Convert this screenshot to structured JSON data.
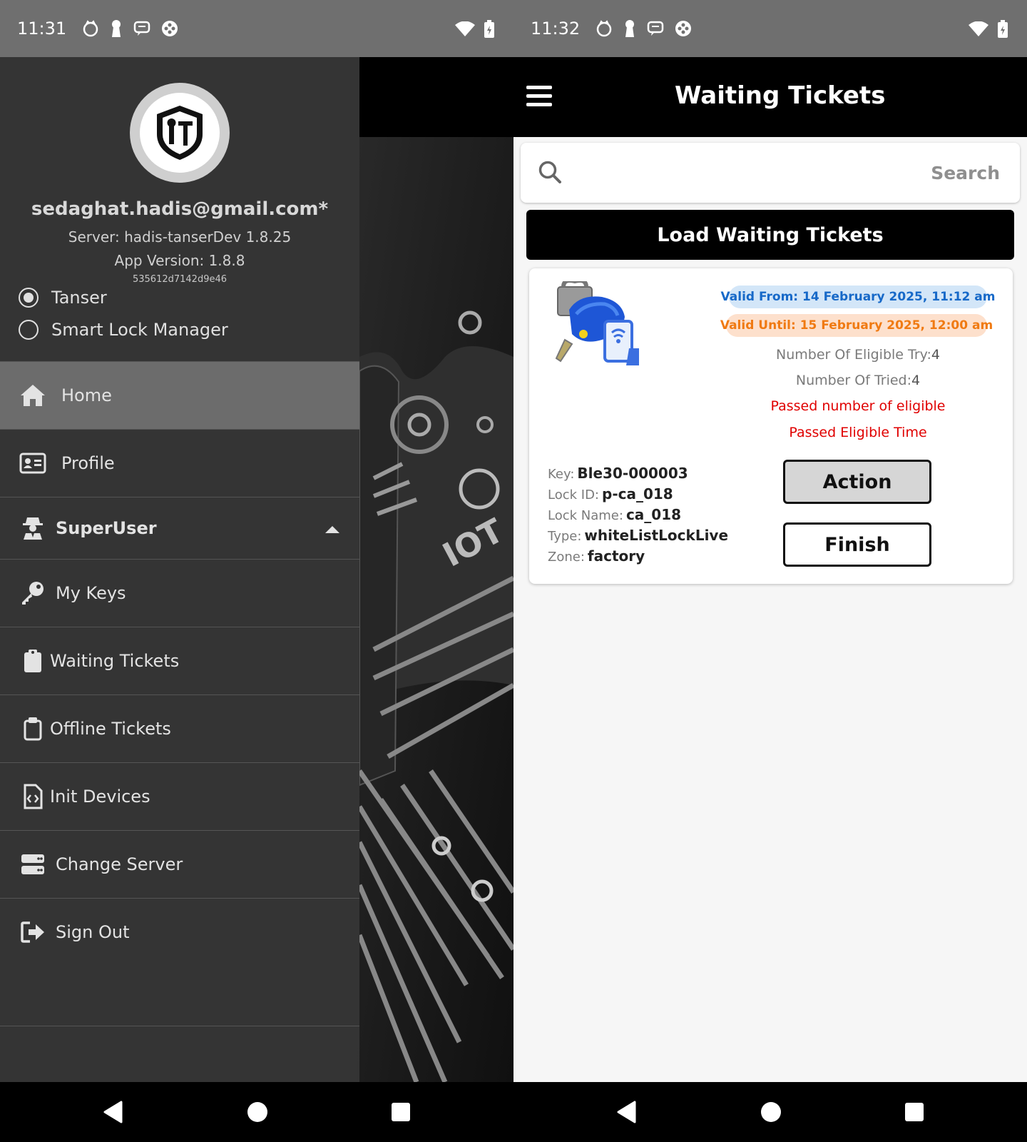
{
  "status_left": {
    "time": "11:31"
  },
  "status_right": {
    "time": "11:32"
  },
  "drawer": {
    "email": "sedaghat.hadis@gmail.com*",
    "server": "Server: hadis-tanserDev 1.8.25",
    "app_version": "App Version: 1.8.8",
    "device_hash": "535612d7142d9e46",
    "mode_options": [
      {
        "label": "Tanser",
        "selected": true
      },
      {
        "label": "Smart Lock Manager",
        "selected": false
      }
    ],
    "menu": [
      {
        "label": "Home",
        "icon": "home-icon",
        "active": true
      },
      {
        "label": "Profile",
        "icon": "id-card-icon"
      },
      {
        "label": "SuperUser",
        "icon": "user-secret-icon",
        "expanded": true
      },
      {
        "label": "My Keys",
        "icon": "key-icon"
      },
      {
        "label": "Waiting Tickets",
        "icon": "clipboard-icon"
      },
      {
        "label": "Offline Tickets",
        "icon": "clipboard-outline-icon"
      },
      {
        "label": "Init Devices",
        "icon": "file-code-icon"
      },
      {
        "label": "Change Server",
        "icon": "server-icon"
      },
      {
        "label": "Sign Out",
        "icon": "sign-out-icon"
      }
    ]
  },
  "appbar": {
    "title": "Waiting Tickets"
  },
  "search": {
    "placeholder": "Search"
  },
  "load_button": "Load Waiting Tickets",
  "ticket": {
    "valid_from": "Valid From: 14 February 2025, 11:12 am",
    "valid_until": "Valid Until: 15 February 2025, 12:00 am",
    "eligible_try_label": "Number Of Eligible Try:",
    "eligible_try_value": "4",
    "tried_label": "Number Of Tried:",
    "tried_value": "4",
    "warning_1": "Passed number of eligible",
    "warning_2": "Passed Eligible Time",
    "key_label": "Key:",
    "key_value": "Ble30-000003",
    "lock_id_label": "Lock ID:",
    "lock_id_value": "p-ca_018",
    "lock_name_label": "Lock Name:",
    "lock_name_value": "ca_018",
    "type_label": "Type:",
    "type_value": "whiteListLockLive",
    "zone_label": "Zone:",
    "zone_value": "factory",
    "action_label": "Action",
    "finish_label": "Finish"
  },
  "colors": {
    "drawer_bg": "#343434",
    "active_item_bg": "#6c6c6c",
    "valid_from_text": "#1769c8",
    "valid_until_text": "#f07a12",
    "warning_text": "#e00000"
  }
}
